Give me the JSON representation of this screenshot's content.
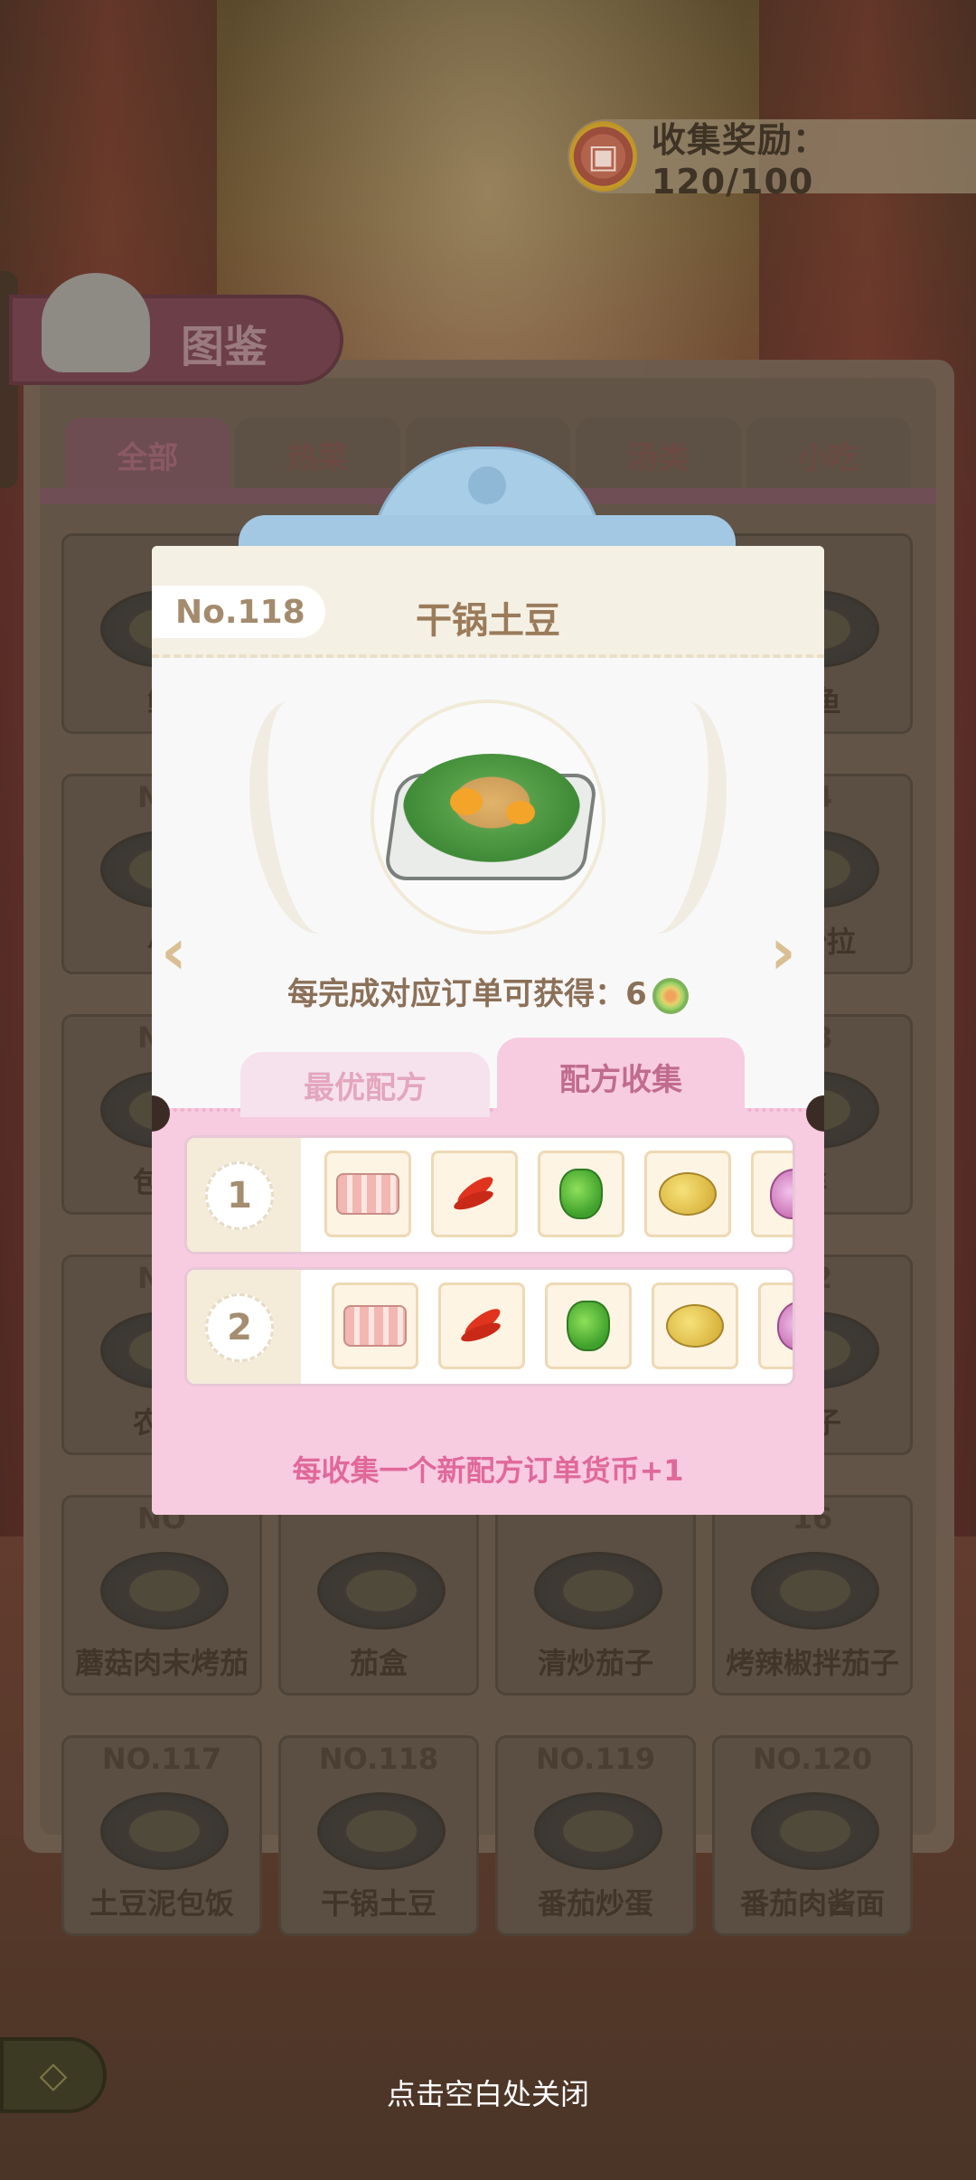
{
  "reward": {
    "label": "收集奖励：120/100"
  },
  "book": {
    "title": "图鉴",
    "tabs": [
      "全部",
      "热菜",
      "凉菜",
      "汤类",
      "小吃"
    ],
    "cards": [
      {
        "no": "",
        "name": "鱿"
      },
      {
        "no": "",
        "name": ""
      },
      {
        "no": "",
        "name": ""
      },
      {
        "no": "",
        "name": "文鱼"
      },
      {
        "no": "NO",
        "name": "小"
      },
      {
        "no": "",
        "name": ""
      },
      {
        "no": "",
        "name": ""
      },
      {
        "no": "04",
        "name": "蔬沙拉"
      },
      {
        "no": "NO",
        "name": "包菜"
      },
      {
        "no": "",
        "name": ""
      },
      {
        "no": "",
        "name": ""
      },
      {
        "no": "08",
        "name": "鲜"
      },
      {
        "no": "NO",
        "name": "农家"
      },
      {
        "no": "",
        "name": ""
      },
      {
        "no": "",
        "name": ""
      },
      {
        "no": "12",
        "name": "茄子"
      },
      {
        "no": "NO",
        "name": "蘑菇肉末烤茄"
      },
      {
        "no": "",
        "name": "茄盒"
      },
      {
        "no": "",
        "name": "清炒茄子"
      },
      {
        "no": "16",
        "name": "烤辣椒拌茄子"
      },
      {
        "no": "NO.117",
        "name": "土豆泥包饭"
      },
      {
        "no": "NO.118",
        "name": "干锅土豆"
      },
      {
        "no": "NO.119",
        "name": "番茄炒蛋"
      },
      {
        "no": "NO.120",
        "name": "番茄肉酱面"
      }
    ]
  },
  "modal": {
    "number": "No.118",
    "dish_name": "干锅土豆",
    "earn_text": "每完成对应订单可获得：6",
    "prev_arrow": "‹",
    "next_arrow": "›",
    "tabs": {
      "best": "最优配方",
      "collection": "配方收集"
    },
    "recipes": [
      {
        "index": "1",
        "ingredients": [
          "meat-slice-icon",
          "chili-icon",
          "green-pepper-icon",
          "potato-icon",
          "onion-icon"
        ]
      },
      {
        "index": "2",
        "ingredients": [
          "meat-slice-icon",
          "chili-icon",
          "green-pepper-icon",
          "potato-icon",
          "onion-icon"
        ]
      }
    ],
    "collect_tip": "每收集一个新配方订单货币+1"
  },
  "close_hint": "点击空白处关闭"
}
